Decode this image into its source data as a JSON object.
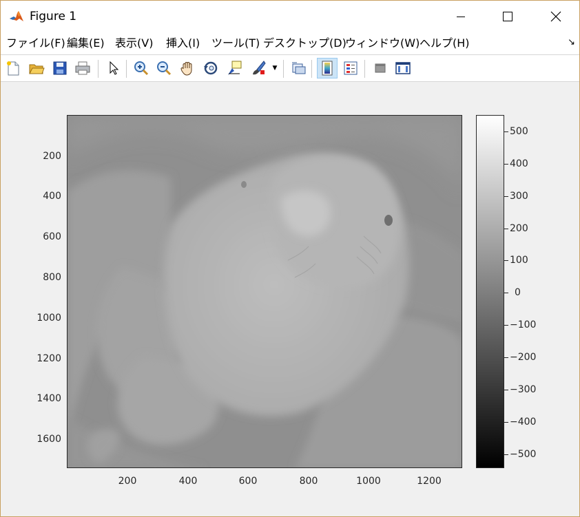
{
  "window": {
    "title": "Figure 1",
    "controls": {
      "minimize": "minimize",
      "maximize": "maximize",
      "close": "close"
    }
  },
  "menu": {
    "items": [
      "ファイル(F)",
      "編集(E)",
      "表示(V)",
      "挿入(I)",
      "ツール(T)",
      "デスクトップ(D)",
      "ウィンドウ(W)",
      "ヘルプ(H)"
    ]
  },
  "toolbar": {
    "tools": [
      {
        "icon": "new-figure-icon"
      },
      {
        "icon": "open-folder-icon"
      },
      {
        "icon": "save-icon"
      },
      {
        "icon": "print-icon"
      },
      {
        "icon": "edit-plot-arrow-icon"
      },
      {
        "icon": "zoom-in-icon"
      },
      {
        "icon": "zoom-out-icon"
      },
      {
        "icon": "pan-hand-icon"
      },
      {
        "icon": "rotate-3d-icon"
      },
      {
        "icon": "data-cursor-icon"
      },
      {
        "icon": "brush-icon"
      },
      {
        "icon": "link-plot-icon"
      },
      {
        "icon": "insert-colorbar-icon",
        "active": true
      },
      {
        "icon": "insert-legend-icon"
      },
      {
        "icon": "hide-plot-tools-icon"
      },
      {
        "icon": "show-plot-tools-icon"
      }
    ]
  },
  "axes": {
    "image": "grayscale photo of a budgerigar held in a hand",
    "yticks": [
      "200",
      "400",
      "600",
      "800",
      "1000",
      "1200",
      "1400",
      "1600"
    ],
    "xticks": [
      "200",
      "400",
      "600",
      "800",
      "1000",
      "1200"
    ]
  },
  "colorbar": {
    "ticks": [
      "500",
      "400",
      "300",
      "200",
      "100",
      "0",
      "−100",
      "−200",
      "−300",
      "−400",
      "−500"
    ]
  }
}
